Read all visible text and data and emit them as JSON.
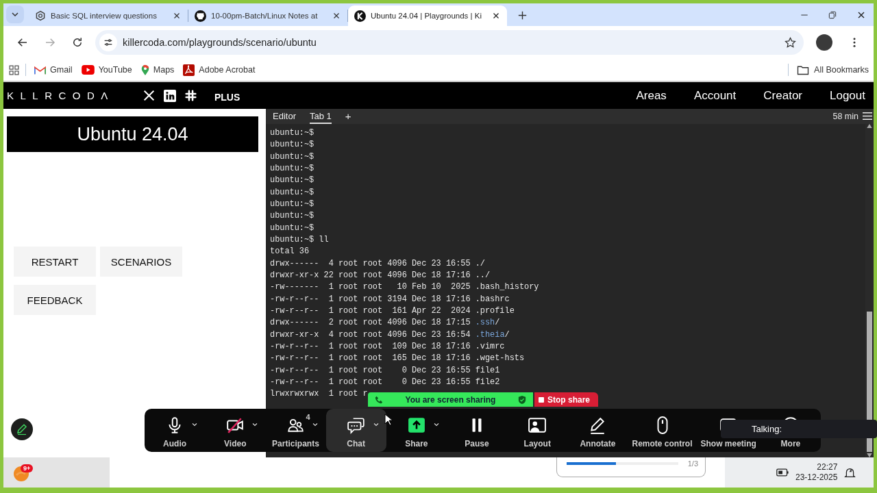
{
  "browser": {
    "tabs": [
      {
        "title": "Basic SQL interview questions",
        "selected": false,
        "kind": "hexagon"
      },
      {
        "title": "10-00pm-Batch/Linux Notes at",
        "selected": false,
        "kind": "cat"
      },
      {
        "title": "Ubuntu 24.04 | Playgrounds | Ki",
        "selected": true,
        "kind": "letter"
      }
    ],
    "url": "killercoda.com/playgrounds/scenario/ubuntu",
    "forward_disabled": true,
    "bookmarks": [
      {
        "label": "Gmail",
        "kind": "mail"
      },
      {
        "label": "YouTube",
        "kind": "video"
      },
      {
        "label": "Maps",
        "kind": "pin"
      },
      {
        "label": "Adobe Acrobat",
        "kind": "pdf"
      }
    ],
    "all_bookmarks": "All Bookmarks"
  },
  "site": {
    "logo": "KLLRCODΛ",
    "plus": "PLUS",
    "nav": [
      "Areas",
      "Account",
      "Creator",
      "Logout"
    ]
  },
  "sidebar": {
    "title": "Ubuntu 24.04",
    "buttons": [
      "RESTART",
      "SCENARIOS",
      "FEEDBACK"
    ]
  },
  "terminal": {
    "tabs": [
      {
        "label": "Editor",
        "selected": false
      },
      {
        "label": "Tab 1",
        "selected": true
      }
    ],
    "add": "+",
    "timer": "58 min",
    "lines": [
      {
        "text": "ubuntu:~$"
      },
      {
        "text": "ubuntu:~$"
      },
      {
        "text": "ubuntu:~$"
      },
      {
        "text": "ubuntu:~$"
      },
      {
        "text": "ubuntu:~$"
      },
      {
        "text": "ubuntu:~$"
      },
      {
        "text": "ubuntu:~$"
      },
      {
        "text": "ubuntu:~$"
      },
      {
        "text": "ubuntu:~$"
      },
      {
        "text": "ubuntu:~$ ll"
      },
      {
        "text": "total 36"
      },
      {
        "text": "drwx------  4 root root 4096 Dec 23 16:55 ./"
      },
      {
        "text": "drwxr-xr-x 22 root root 4096 Dec 18 17:16 ../"
      },
      {
        "text": "-rw-------  1 root root   10 Feb 10  2025 .bash_history"
      },
      {
        "text": "-rw-r--r--  1 root root 3194 Dec 18 17:16 .bashrc"
      },
      {
        "text": "-rw-r--r--  1 root root  161 Apr 22  2024 .profile"
      },
      {
        "text": "drwx------  2 root root 4096 Dec 18 17:15 ",
        "name": ".ssh",
        "suffix": "/",
        "color": "#7aa6da"
      },
      {
        "text": "drwxr-xr-x  4 root root 4096 Dec 23 16:54 ",
        "name": ".theia",
        "suffix": "/",
        "color": "#7aa6da"
      },
      {
        "text": "-rw-r--r--  1 root root  109 Dec 18 17:16 .vimrc"
      },
      {
        "text": "-rw-r--r--  1 root root  165 Dec 18 17:16 .wget-hsts"
      },
      {
        "text": "-rw-r--r--  1 root root    0 Dec 23 16:55 file1"
      },
      {
        "text": "-rw-r--r--  1 root root    0 Dec 23 16:55 file2"
      },
      {
        "text": "lrwxrwxrwx  1 root r"
      }
    ]
  },
  "meeting": {
    "banner": "You are screen sharing",
    "stop": "Stop share",
    "talking": "Talking:",
    "controls": [
      {
        "kind": "audio",
        "label": "Audio",
        "menu": true,
        "off": false,
        "selected": false
      },
      {
        "kind": "video",
        "label": "Video",
        "menu": true,
        "off": true,
        "selected": false
      },
      {
        "kind": "participants",
        "label": "Participants",
        "count": "4",
        "menu": true,
        "off": false,
        "selected": false
      },
      {
        "kind": "chat",
        "label": "Chat",
        "menu": true,
        "off": false,
        "selected": true
      },
      {
        "kind": "share",
        "label": "Share",
        "menu": true,
        "off": false,
        "selected": false
      },
      {
        "kind": "pause",
        "label": "Pause",
        "menu": false,
        "off": false,
        "selected": false
      },
      {
        "kind": "layout",
        "label": "Layout",
        "menu": false,
        "off": false,
        "selected": false
      },
      {
        "kind": "annotate",
        "label": "Annotate",
        "menu": false,
        "off": false,
        "selected": false
      },
      {
        "kind": "remote",
        "label": "Remote control",
        "menu": false,
        "off": false,
        "selected": false
      },
      {
        "kind": "meeting",
        "label": "Show meeting",
        "menu": false,
        "selected": false
      },
      {
        "kind": "more",
        "label": "More",
        "menu": false,
        "selected": false
      }
    ]
  },
  "taskbar": {
    "badge": "9+",
    "progress": {
      "level": 0.44,
      "text": "1/3"
    },
    "time": "22:27",
    "date": "23-12-2025"
  }
}
